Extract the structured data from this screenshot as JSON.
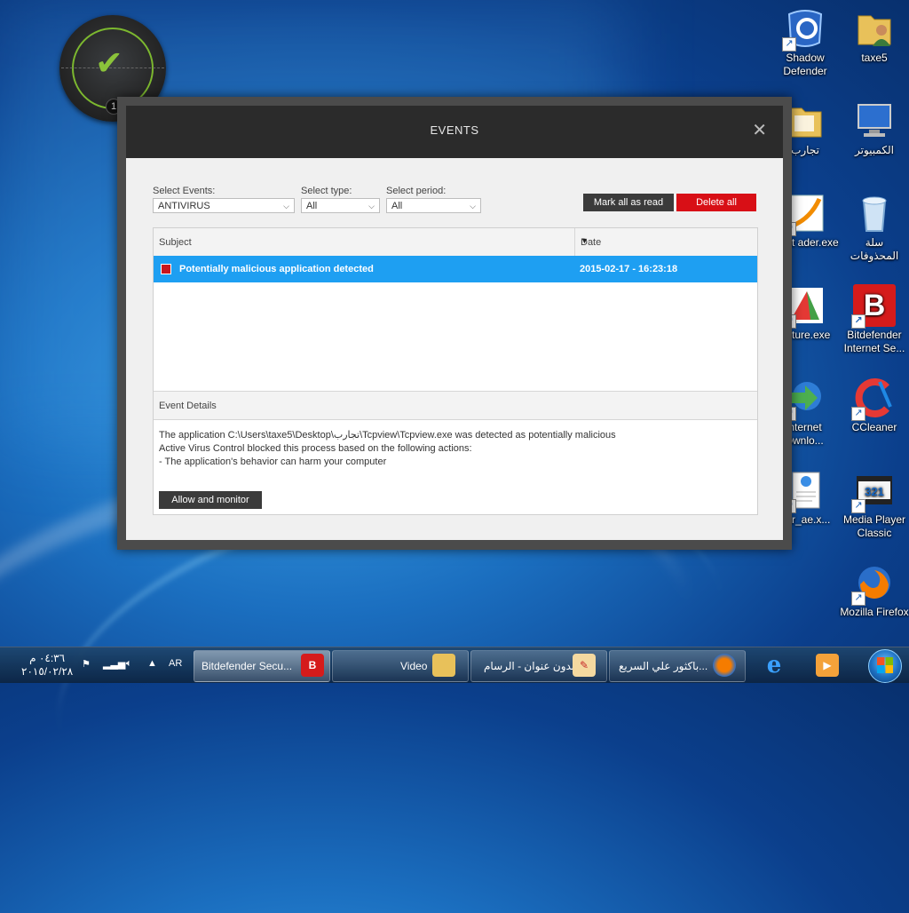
{
  "window": {
    "title": "EVENTS",
    "close_glyph": "✕",
    "filters": {
      "events_label": "Select Events:",
      "events_value": "ANTIVIRUS",
      "type_label": "Select type:",
      "type_value": "All",
      "period_label": "Select period:",
      "period_value": "All"
    },
    "buttons": {
      "mark_all_read": "Mark all as read",
      "delete_all": "Delete all",
      "allow_monitor": "Allow and monitor"
    },
    "table": {
      "col_subject": "Subject",
      "col_date": "Date",
      "rows": [
        {
          "subject": "Potentially malicious application detected",
          "date": "2015-02-17 - 16:23:18"
        }
      ]
    },
    "details": {
      "header": "Event Details",
      "line1": "The application C:\\Users\\taxe5\\Desktop\\تجارب\\Tcpview\\Tcpview.exe was detected as potentially malicious",
      "line2": "Active Virus Control blocked this process based on the following actions:",
      "line3": "- The application's behavior can harm your computer"
    },
    "colors": {
      "accent_blue": "#1e9ff2",
      "danger_red": "#d80f16",
      "dark": "#2b2b2b"
    }
  },
  "gadget": {
    "badge": "1"
  },
  "desktop_icons": [
    {
      "label": "Shadow Defender",
      "icon": "shadow-defender-icon"
    },
    {
      "label": "taxe5",
      "icon": "user-folder-icon"
    },
    {
      "label": "تجارب",
      "icon": "folder-icon"
    },
    {
      "label": "الكمبيوتر",
      "icon": "computer-icon"
    },
    {
      "label": "Foxit ader.exe",
      "icon": "foxit-reader-icon"
    },
    {
      "label": "سلة المحذوفات",
      "icon": "recycle-bin-icon"
    },
    {
      "label": "apture.exe",
      "icon": "capture-icon"
    },
    {
      "label": "Bitdefender Internet Se...",
      "icon": "bitdefender-icon"
    },
    {
      "label": "nternet ownlo...",
      "icon": "download-manager-icon"
    },
    {
      "label": "CCleaner",
      "icon": "ccleaner-icon"
    },
    {
      "label": "_ar_ae.x...",
      "icon": "document-icon"
    },
    {
      "label": "Media Player Classic",
      "icon": "media-player-icon"
    },
    {
      "label": "Mozilla Firefox",
      "icon": "firefox-icon"
    }
  ],
  "taskbar": {
    "clock_time": "٠٤:٣٦ م",
    "clock_date": "٢٠١٥/٠٢/٢٨",
    "lang": "AR",
    "tasks": [
      {
        "label": "Bitdefender Secu...",
        "icon": "bitdefender-icon"
      },
      {
        "label": "Video",
        "icon": "folder-icon"
      },
      {
        "label": "بدون عنوان - الرسام",
        "icon": "paint-icon"
      },
      {
        "label": "باكثور علي السريع...",
        "icon": "firefox-icon"
      }
    ]
  }
}
